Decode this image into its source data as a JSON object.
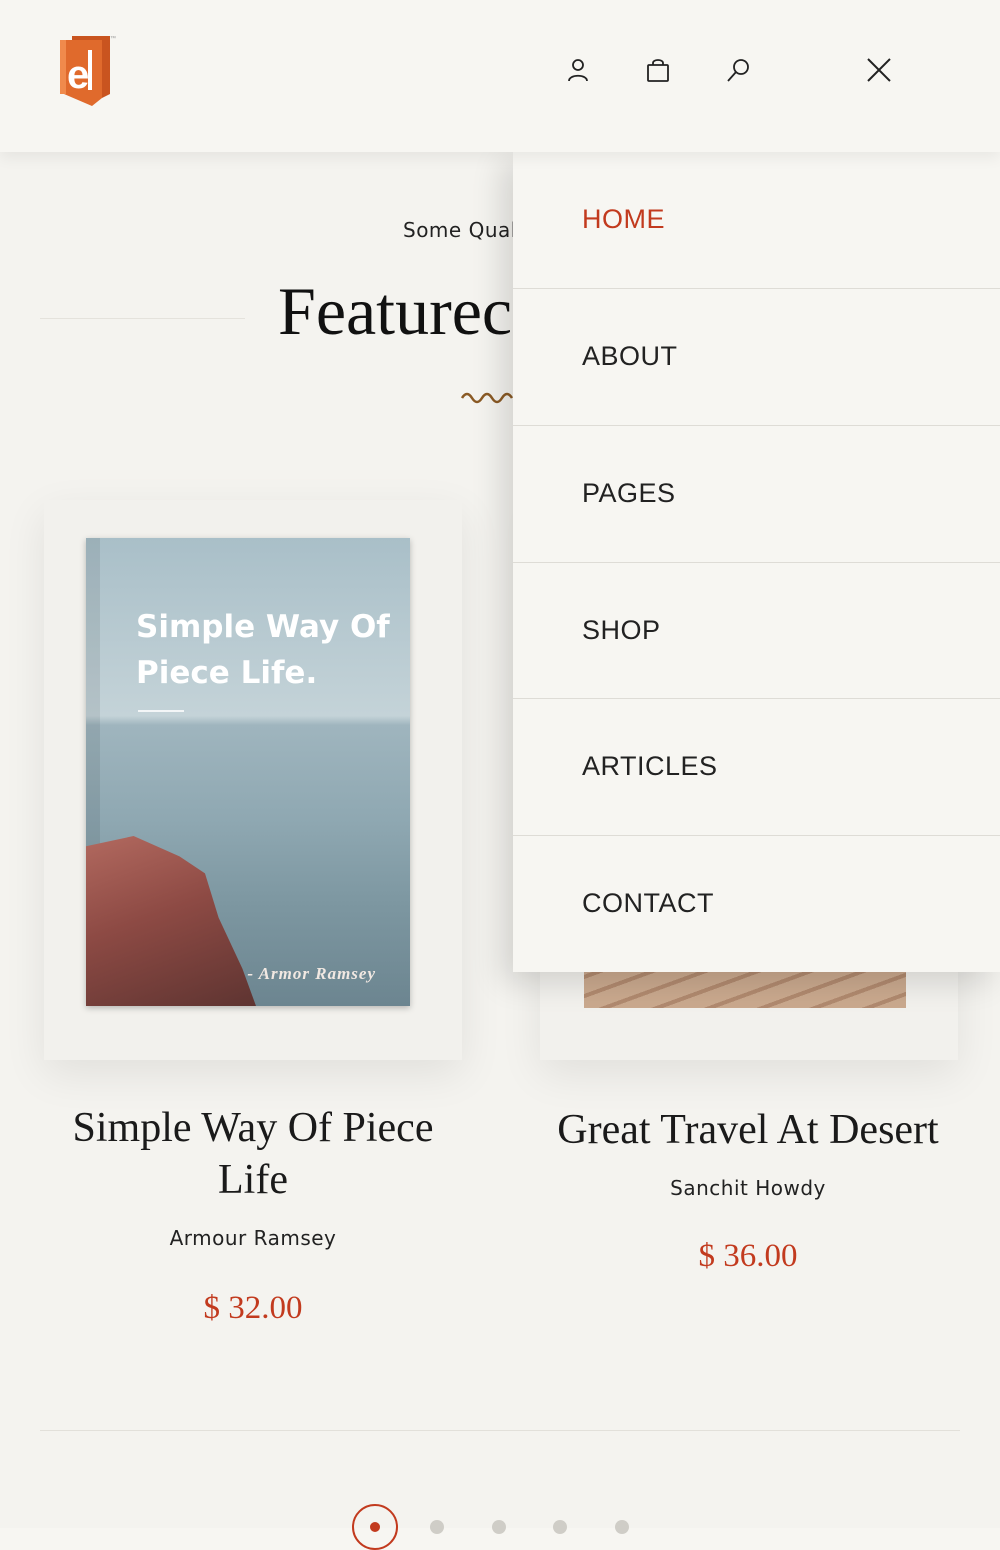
{
  "header": {
    "logo_letter": "e",
    "icons": [
      "user-icon",
      "bag-icon",
      "search-icon",
      "close-icon"
    ]
  },
  "hero": {
    "eyebrow": "Some Qual",
    "title": "Featurec"
  },
  "menu": {
    "items": [
      {
        "label": "HOME",
        "active": true
      },
      {
        "label": "ABOUT",
        "active": false
      },
      {
        "label": "PAGES",
        "active": false
      },
      {
        "label": "SHOP",
        "active": false
      },
      {
        "label": "ARTICLES",
        "active": false
      },
      {
        "label": "CONTACT",
        "active": false
      }
    ]
  },
  "products": [
    {
      "cover_title": "Simple Way Of Piece Life.",
      "cover_author": "- Armor Ramsey",
      "title": "Simple Way Of Piece Life",
      "author": "Armour Ramsey",
      "price": "$ 32.00"
    },
    {
      "title": "Great Travel At Desert",
      "author": "Sanchit Howdy",
      "price": "$ 36.00"
    }
  ],
  "carousel": {
    "dots": 5,
    "active_index": 0
  },
  "colors": {
    "accent": "#c23a1e",
    "logo": "#e06a2c",
    "background": "#f7f6f2"
  }
}
